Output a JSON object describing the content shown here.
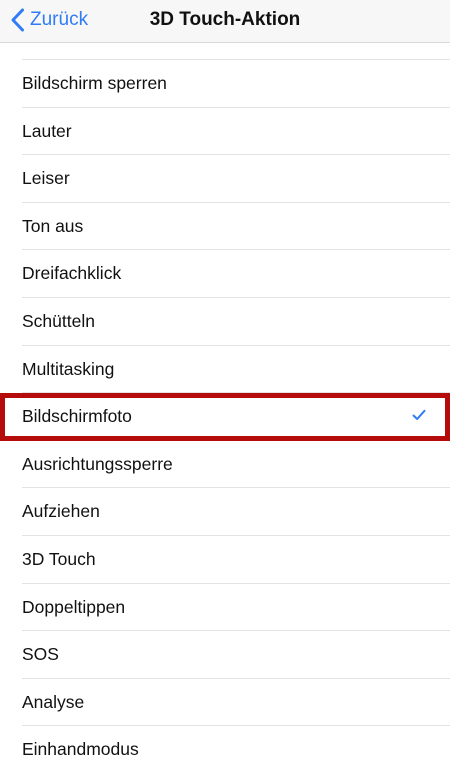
{
  "navbar": {
    "back_label": "Zurück",
    "title": "3D Touch-Aktion"
  },
  "colors": {
    "accent": "#2f7cf6",
    "highlight": "#b50b0b"
  },
  "list": {
    "items": [
      {
        "label": "Bildschirm sperren",
        "selected": false
      },
      {
        "label": "Lauter",
        "selected": false
      },
      {
        "label": "Leiser",
        "selected": false
      },
      {
        "label": "Ton aus",
        "selected": false
      },
      {
        "label": "Dreifachklick",
        "selected": false
      },
      {
        "label": "Schütteln",
        "selected": false
      },
      {
        "label": "Multitasking",
        "selected": false
      },
      {
        "label": "Bildschirmfoto",
        "selected": true
      },
      {
        "label": "Ausrichtungssperre",
        "selected": false
      },
      {
        "label": "Aufziehen",
        "selected": false
      },
      {
        "label": "3D Touch",
        "selected": false
      },
      {
        "label": "Doppeltippen",
        "selected": false
      },
      {
        "label": "SOS",
        "selected": false
      },
      {
        "label": "Analyse",
        "selected": false
      },
      {
        "label": "Einhandmodus",
        "selected": false
      }
    ]
  }
}
